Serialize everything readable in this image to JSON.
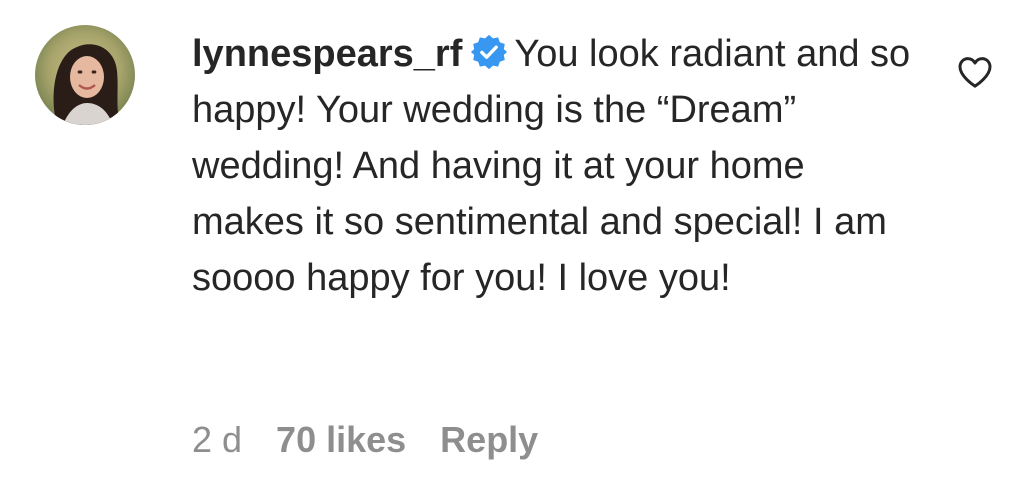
{
  "comment": {
    "username": "lynnespears_rf",
    "verified_icon": "verified-badge-icon",
    "text": "You look radiant and so happy! Your wedding is the “Dream” wedding! And having it at your home makes it so sentimental and special! I am soooo happy for you! I love you!",
    "time": "2 d",
    "likes": "70 likes",
    "reply_label": "Reply",
    "like_icon": "heart-outline-icon"
  },
  "colors": {
    "verified_blue": "#3897f0",
    "meta_gray": "#8e8e8e",
    "text_dark": "#262626"
  }
}
